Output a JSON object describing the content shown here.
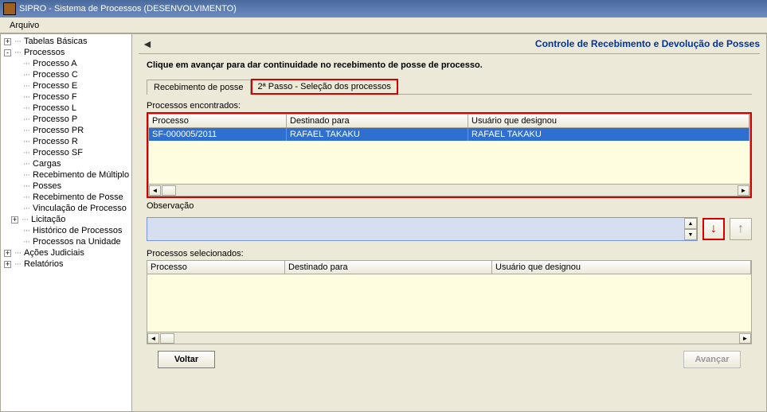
{
  "window": {
    "title": "SIPRO - Sistema de Processos (DESENVOLVIMENTO)"
  },
  "menu": {
    "arquivo": "Arquivo"
  },
  "sidebar": {
    "tabelas_basicas": "Tabelas Básicas",
    "processos": "Processos",
    "children": [
      "Processo A",
      "Processo C",
      "Processo E",
      "Processo F",
      "Processo L",
      "Processo P",
      "Processo PR",
      "Processo R",
      "Processo SF",
      "Cargas",
      "Recebimento de Múltiplo",
      "Posses",
      "Recebimento de Posse",
      "Vinculação de Processo",
      "Licitação",
      "Histórico de Processos",
      "Processos na Unidade"
    ],
    "acoes": "Ações Judiciais",
    "relatorios": "Relatórios"
  },
  "header": {
    "page_title": "Controle de Recebimento e Devolução de Posses",
    "instruction": "Clique em avançar para dar continuidade no recebimento de posse de processo."
  },
  "tabs": {
    "tab1": "Recebimento de posse",
    "tab2": "2ª Passo - Seleção dos processos"
  },
  "found": {
    "label": "Processos encontrados:",
    "headers": {
      "c1": "Processo",
      "c2": "Destinado para",
      "c3": "Usuário que designou"
    },
    "rows": [
      {
        "c1": "SF-000005/2011",
        "c2": "RAFAEL TAKAKU",
        "c3": "RAFAEL TAKAKU"
      }
    ]
  },
  "obs": {
    "label": "Observação"
  },
  "selected": {
    "label": "Processos selecionados:",
    "headers": {
      "c1": "Processo",
      "c2": "Destinado para",
      "c3": "Usuário que designou"
    }
  },
  "buttons": {
    "voltar": "Voltar",
    "avancar": "Avançar"
  }
}
